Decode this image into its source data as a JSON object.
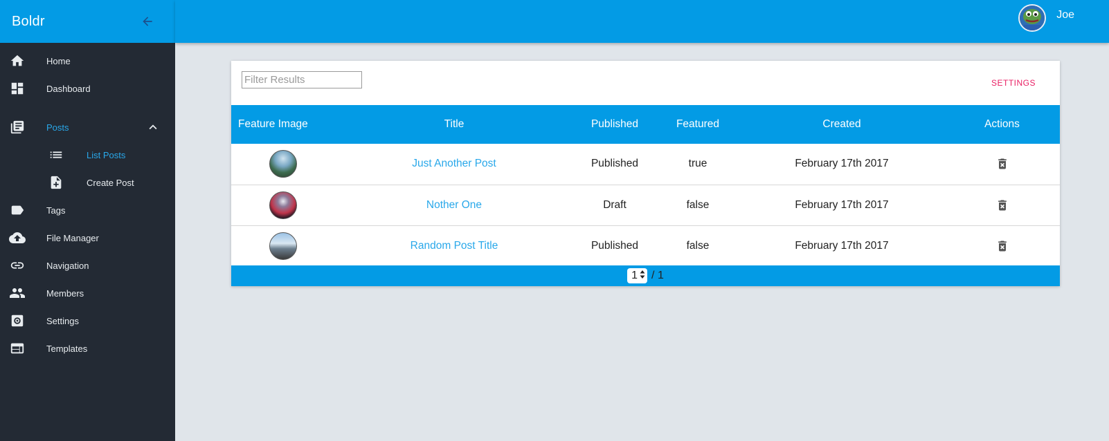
{
  "app": {
    "brand": "Boldr"
  },
  "user": {
    "name": "Joe"
  },
  "sidebar": {
    "items": [
      {
        "label": "Home",
        "icon": "home-icon"
      },
      {
        "label": "Dashboard",
        "icon": "dashboard-icon"
      },
      {
        "label": "Posts",
        "icon": "posts-icon",
        "active": true,
        "expanded": true,
        "children": [
          {
            "label": "List Posts",
            "icon": "list-icon",
            "active": true
          },
          {
            "label": "Create Post",
            "icon": "create-post-icon"
          }
        ]
      },
      {
        "label": "Tags",
        "icon": "tag-icon"
      },
      {
        "label": "File Manager",
        "icon": "cloud-upload-icon"
      },
      {
        "label": "Navigation",
        "icon": "link-icon"
      },
      {
        "label": "Members",
        "icon": "people-icon"
      },
      {
        "label": "Settings",
        "icon": "settings-icon"
      },
      {
        "label": "Templates",
        "icon": "template-icon"
      }
    ]
  },
  "filter": {
    "placeholder": "Filter Results",
    "value": ""
  },
  "toolbar": {
    "settings_label": "SETTINGS"
  },
  "table": {
    "headers": [
      "Feature Image",
      "Title",
      "Published",
      "Featured",
      "Created",
      "Actions"
    ],
    "rows": [
      {
        "title": "Just Another Post",
        "published": "Published",
        "featured": "true",
        "created": "February 17th 2017"
      },
      {
        "title": "Nother One",
        "published": "Draft",
        "featured": "false",
        "created": "February 17th 2017"
      },
      {
        "title": "Random Post Title",
        "published": "Published",
        "featured": "false",
        "created": "February 17th 2017"
      }
    ]
  },
  "pagination": {
    "current": "1",
    "total_label": "/ 1"
  },
  "colors": {
    "primary": "#039be5",
    "sidebar_bg": "#232a34",
    "accent": "#e91e63",
    "link": "#29a8ea",
    "page_bg": "#e0e5ea"
  }
}
